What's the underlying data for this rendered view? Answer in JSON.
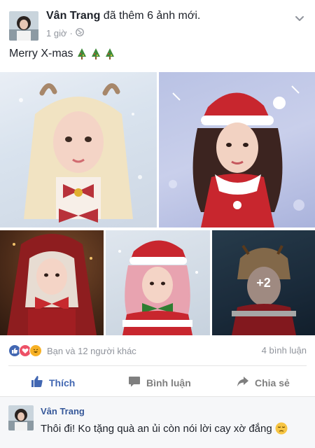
{
  "post": {
    "author": "Vân Trang",
    "action_text": " đã thêm 6 ảnh mới.",
    "time": "1 giờ",
    "message": "Merry X-mas",
    "hidden_photo_count": "+2"
  },
  "reactions": {
    "summary": "Bạn và 12 người khác",
    "comment_count": "4 bình luận"
  },
  "actions": {
    "like_label": "Thích",
    "comment_label": "Bình luận",
    "share_label": "Chia sẻ"
  },
  "comment": {
    "author": "Vân Trang",
    "text": "Thôi đi! Ko tặng quà an ủi còn nói lời cay xờ đắng"
  },
  "colors": {
    "facebook_blue": "#4267b2",
    "meta_gray": "#90949c",
    "love_red": "#ed5167",
    "haha_yellow": "#f7b125"
  },
  "icons": [
    "globe-icon",
    "chevron-down-icon",
    "christmas-tree-icon",
    "like-reaction-icon",
    "love-reaction-icon",
    "haha-reaction-icon",
    "thumbs-up-icon",
    "comment-icon",
    "share-icon",
    "pensive-emoji-icon"
  ]
}
